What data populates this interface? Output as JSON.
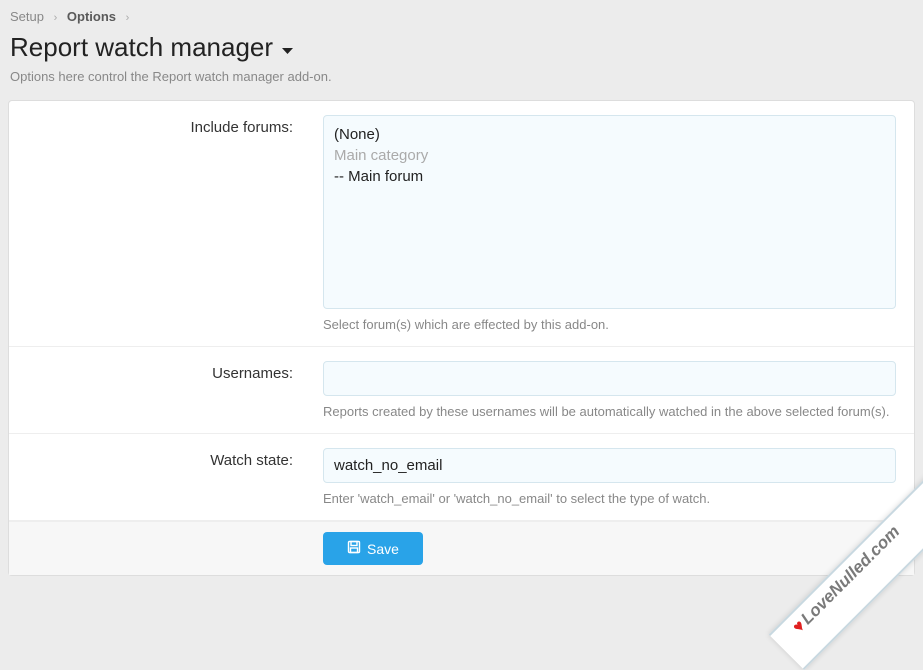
{
  "breadcrumb": {
    "setup": "Setup",
    "options": "Options"
  },
  "title": "Report watch manager",
  "description": "Options here control the Report watch manager add-on.",
  "fields": {
    "include_forums": {
      "label": "Include forums:",
      "options": {
        "none": "(None)",
        "main_category": "Main category",
        "main_forum": "-- Main forum"
      },
      "hint": "Select forum(s) which are effected by this add-on."
    },
    "usernames": {
      "label": "Usernames:",
      "value": "",
      "hint": "Reports created by these usernames will be automatically watched in the above selected forum(s)."
    },
    "watch_state": {
      "label": "Watch state:",
      "value": "watch_no_email",
      "hint": "Enter 'watch_email' or 'watch_no_email' to select the type of watch."
    }
  },
  "buttons": {
    "save": "Save"
  },
  "watermark": "LoveNulled.com"
}
